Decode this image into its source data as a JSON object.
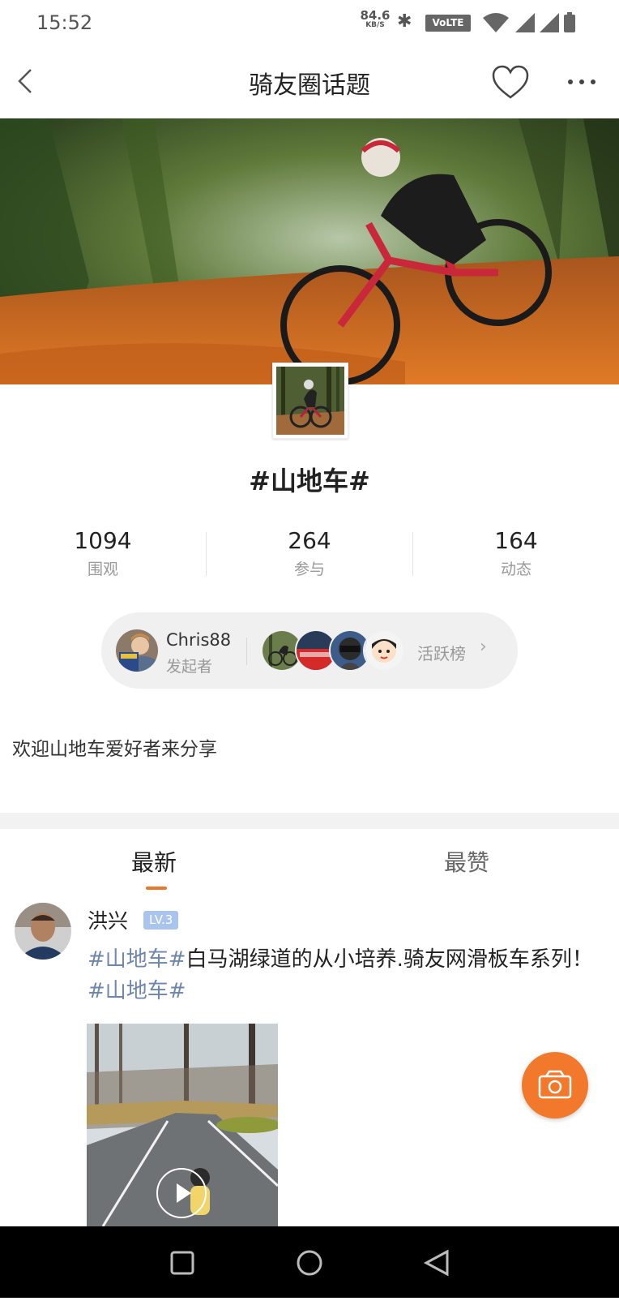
{
  "status_bar": {
    "time": "15:52",
    "net_speed_value": "84.6",
    "net_speed_unit": "KB/S",
    "volte": "VoLTE"
  },
  "header": {
    "title": "骑友圈话题"
  },
  "topic": {
    "title": "#山地车#",
    "description": "欢迎山地车爱好者来分享"
  },
  "stats": [
    {
      "value": "1094",
      "label": "围观"
    },
    {
      "value": "264",
      "label": "参与"
    },
    {
      "value": "164",
      "label": "动态"
    }
  ],
  "initiator": {
    "name": "Chris88",
    "role": "发起者",
    "active_label": "活跃榜"
  },
  "tabs": [
    {
      "label": "最新",
      "active": true
    },
    {
      "label": "最赞",
      "active": false
    }
  ],
  "post": {
    "author": "洪兴",
    "level": "LV.3",
    "tag1": "#山地车#",
    "text": "白马湖绿道的从小培养.骑友网滑板车系列！",
    "tag2": "#山地车#"
  },
  "colors": {
    "accent": "#f2792b",
    "tag": "#6d86ad",
    "level_badge": "#a9c5ee"
  },
  "icons": [
    "back-icon",
    "heart-icon",
    "more-icon",
    "camera-icon",
    "play-icon",
    "nav-recents-icon",
    "nav-home-icon",
    "nav-back-icon"
  ]
}
